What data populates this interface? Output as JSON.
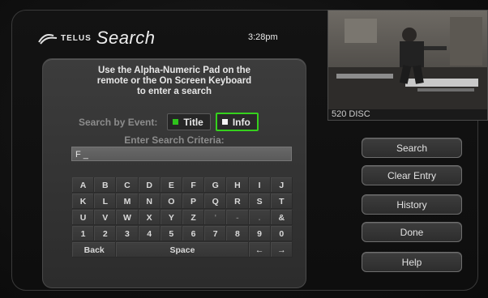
{
  "header": {
    "brand": "TELUS",
    "title": "Search",
    "clock": "3:28pm"
  },
  "instructions": [
    "Use the Alpha-Numeric Pad on the",
    "remote or the On Screen Keyboard",
    "to enter a search"
  ],
  "search_by_event": {
    "label": "Search by Event:",
    "options": [
      {
        "label": "Title",
        "selected": false
      },
      {
        "label": "Info",
        "selected": true
      }
    ]
  },
  "criteria": {
    "label": "Enter Search Criteria:",
    "value": "F _"
  },
  "keyboard": {
    "rows": [
      [
        "A",
        "B",
        "C",
        "D",
        "E",
        "F",
        "G",
        "H",
        "I",
        "J"
      ],
      [
        "K",
        "L",
        "M",
        "N",
        "O",
        "P",
        "Q",
        "R",
        "S",
        "T"
      ],
      [
        "U",
        "V",
        "W",
        "X",
        "Y",
        "Z",
        "'",
        "-",
        ".",
        "&"
      ],
      [
        "1",
        "2",
        "3",
        "4",
        "5",
        "6",
        "7",
        "8",
        "9",
        "0"
      ]
    ],
    "back_label": "Back",
    "space_label": "Space",
    "left_arrow": "←",
    "right_arrow": "→"
  },
  "preview": {
    "caption": "520 DISC"
  },
  "side_buttons": [
    {
      "name": "search-button",
      "label": "Search"
    },
    {
      "name": "clear-entry-button",
      "label": "Clear Entry"
    },
    {
      "name": "history-button",
      "label": "History"
    },
    {
      "name": "done-button",
      "label": "Done"
    },
    {
      "name": "help-button",
      "label": "Help"
    }
  ],
  "colors": {
    "selected_border": "#35d11d",
    "indicator_green": "#2ec31b"
  }
}
